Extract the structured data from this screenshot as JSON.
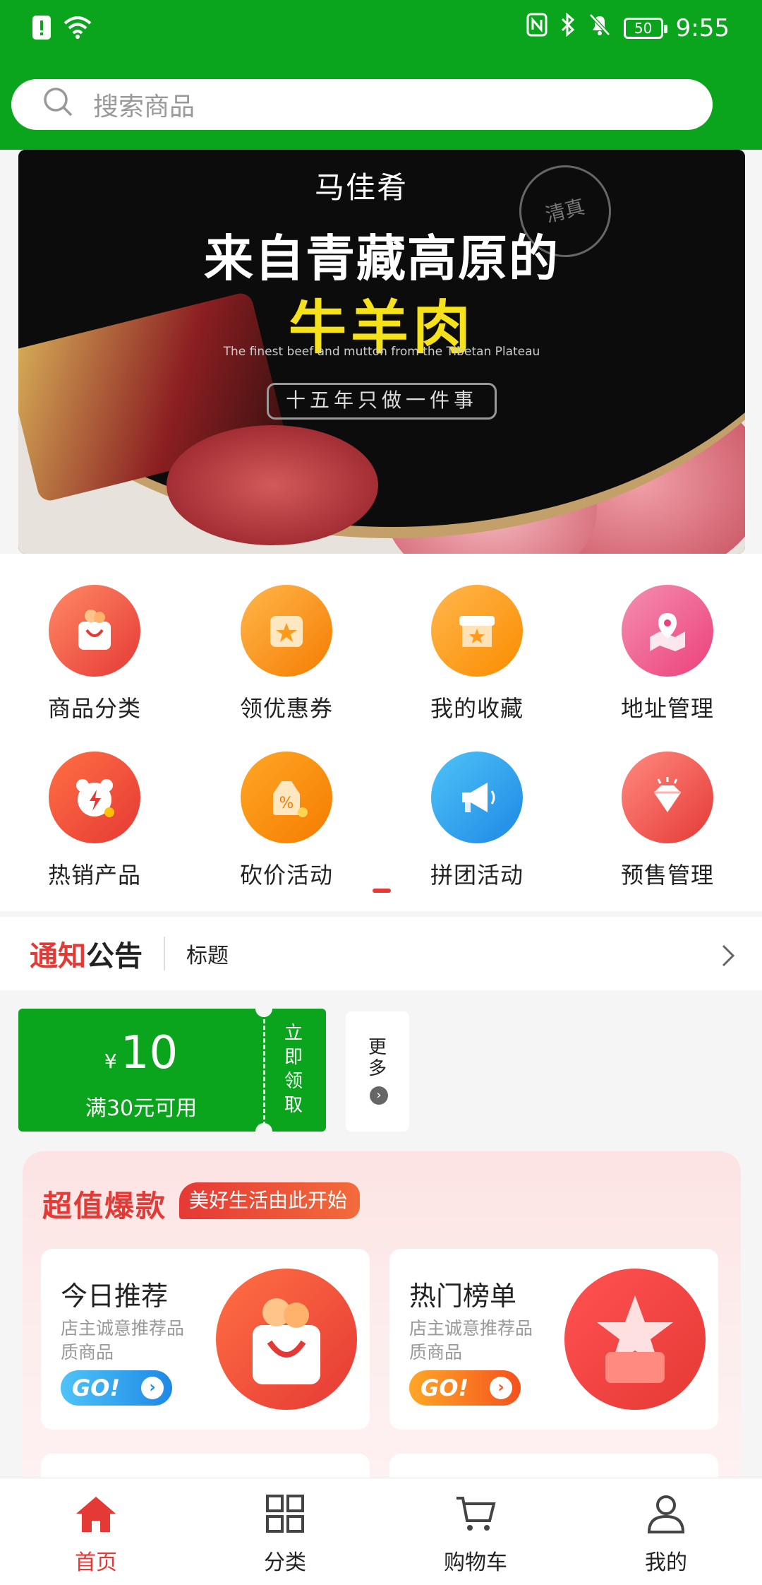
{
  "status": {
    "battery": "50",
    "time": "9:55"
  },
  "search": {
    "placeholder": "搜索商品"
  },
  "banner": {
    "logo": "马佳肴",
    "seal": "清真",
    "title": "来自青藏高原的",
    "subtitle": "牛羊肉",
    "english": "The finest beef and mutton from the Tibetan Plateau",
    "tagline": "十五年只做一件事"
  },
  "grid": {
    "items": [
      {
        "label": "商品分类",
        "icon": "shopping-bag-icon"
      },
      {
        "label": "领优惠券",
        "icon": "coupon-icon"
      },
      {
        "label": "我的收藏",
        "icon": "store-favorite-icon"
      },
      {
        "label": "地址管理",
        "icon": "map-location-icon"
      },
      {
        "label": "热销产品",
        "icon": "hot-sale-icon"
      },
      {
        "label": "砍价活动",
        "icon": "discount-tag-icon"
      },
      {
        "label": "拼团活动",
        "icon": "megaphone-icon"
      },
      {
        "label": "预售管理",
        "icon": "diamond-icon"
      }
    ]
  },
  "notice": {
    "label_red": "通知",
    "label_black": "公告",
    "title": "标题"
  },
  "coupon": {
    "currency": "¥",
    "amount": "10",
    "condition": "满30元可用",
    "action": "立即领取",
    "more": "更多"
  },
  "hot": {
    "title": "超值爆款",
    "slogan": "美好生活由此开始",
    "cards": [
      {
        "title": "今日推荐",
        "desc": "店主诚意推荐品质商品",
        "go": "GO!",
        "icon": "shopping-bag-icon"
      },
      {
        "title": "热门榜单",
        "desc": "店主诚意推荐品质商品",
        "go": "GO!",
        "icon": "star-box-icon"
      }
    ]
  },
  "tabs": [
    {
      "label": "首页",
      "icon": "home-icon"
    },
    {
      "label": "分类",
      "icon": "grid-icon"
    },
    {
      "label": "购物车",
      "icon": "cart-icon"
    },
    {
      "label": "我的",
      "icon": "user-icon"
    }
  ],
  "colors": {
    "brand_green": "#0ba51d",
    "accent_red": "#e53935"
  }
}
